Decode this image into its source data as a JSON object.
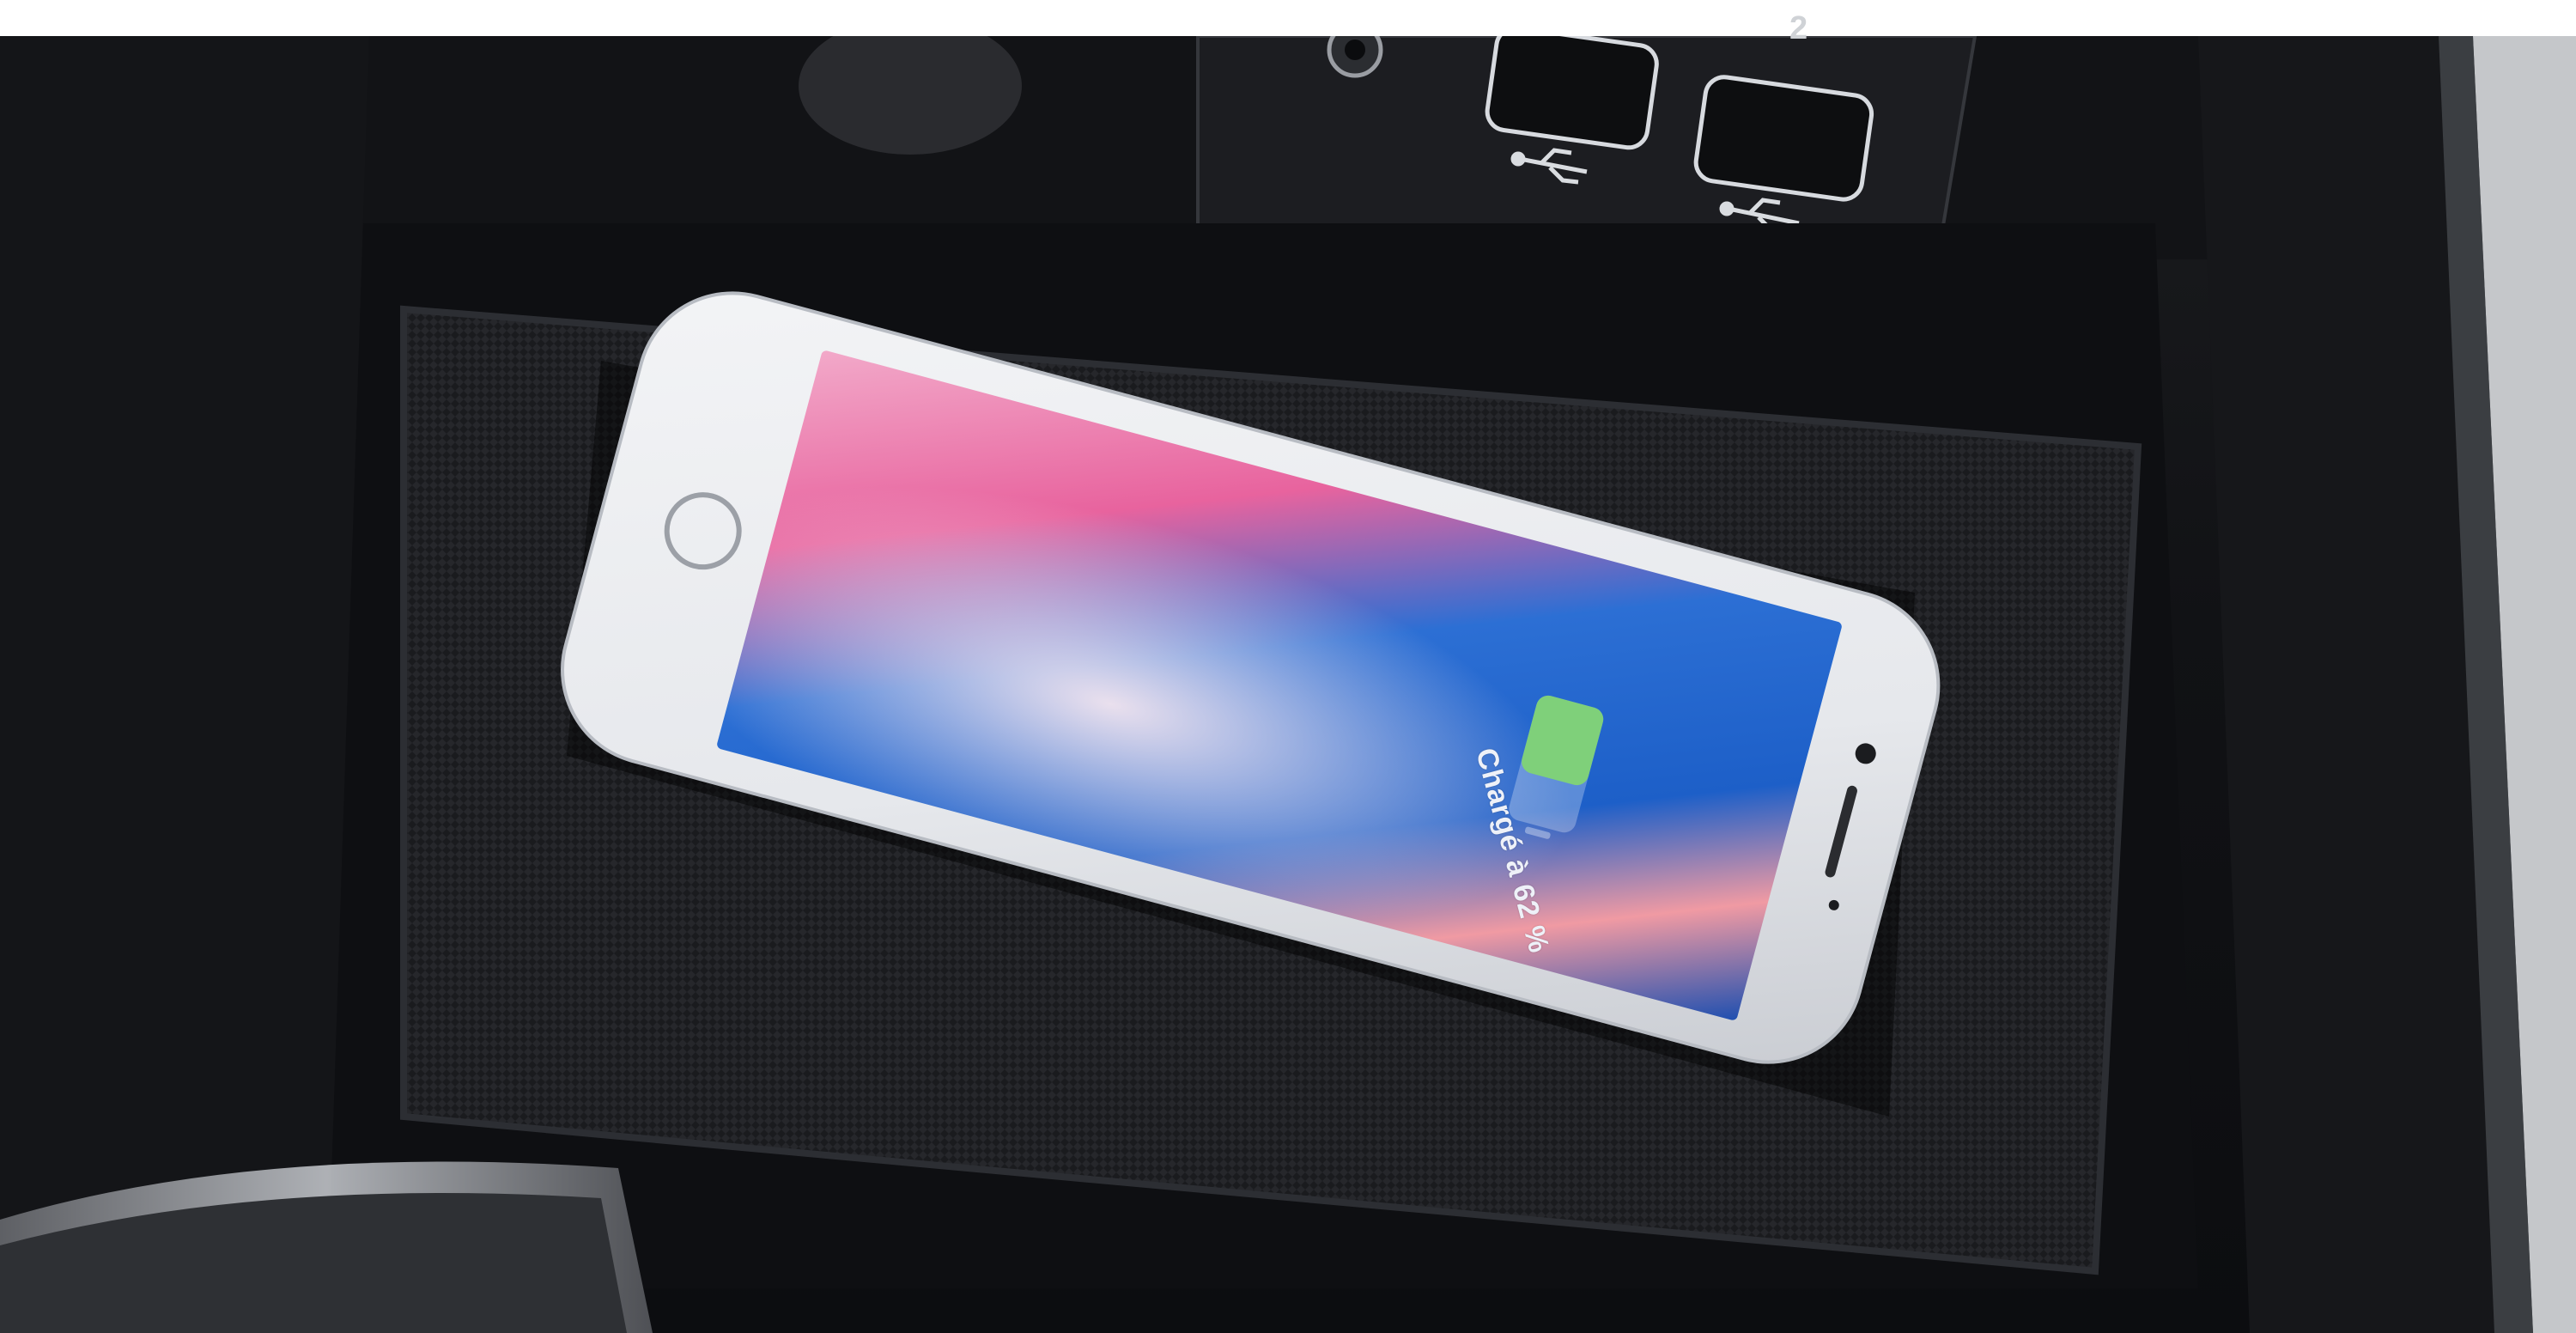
{
  "scene": {
    "phone_status_text": "Chargé à 62 %",
    "usb_port_number": "2",
    "battery_level": 0.62,
    "battery_fill_color": "#7fd07a",
    "icons": [
      "usb-icon",
      "usb-icon",
      "home-button-icon",
      "battery-icon"
    ]
  }
}
